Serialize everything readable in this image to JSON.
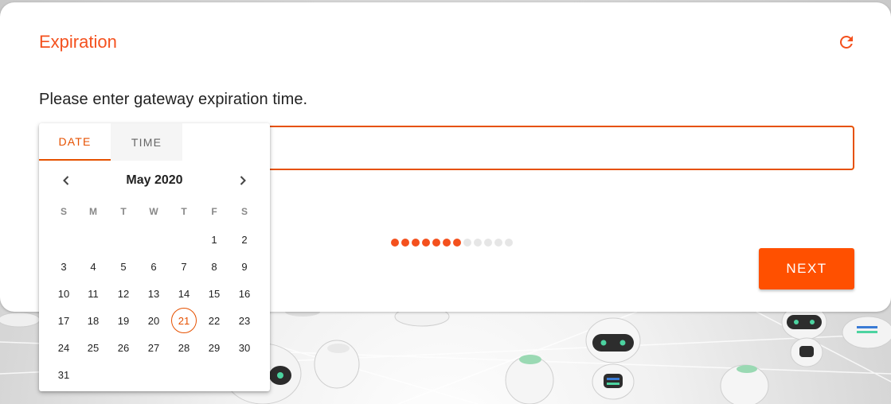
{
  "card": {
    "title": "Expiration",
    "prompt": "Please enter gateway expiration time.",
    "input_value": "",
    "next_label": "NEXT",
    "progress": {
      "completed": 7,
      "total": 12
    }
  },
  "picker": {
    "tabs": [
      {
        "label": "DATE",
        "active": true
      },
      {
        "label": "TIME",
        "active": false
      }
    ],
    "month_label": "May 2020",
    "weekdays": [
      "S",
      "M",
      "T",
      "W",
      "T",
      "F",
      "S"
    ],
    "days": [
      "1",
      "2",
      "3",
      "4",
      "5",
      "6",
      "7",
      "8",
      "9",
      "10",
      "11",
      "12",
      "13",
      "14",
      "15",
      "16",
      "17",
      "18",
      "19",
      "20",
      "21",
      "22",
      "23",
      "24",
      "25",
      "26",
      "27",
      "28",
      "29",
      "30",
      "31"
    ],
    "selected_day": "21"
  },
  "colors": {
    "accent": "#f4511e",
    "button": "#ff5000",
    "dot_inactive": "#e6e6e6"
  },
  "icons": {
    "refresh": "refresh-icon",
    "prev": "chevron-left-icon",
    "next": "chevron-right-icon"
  }
}
